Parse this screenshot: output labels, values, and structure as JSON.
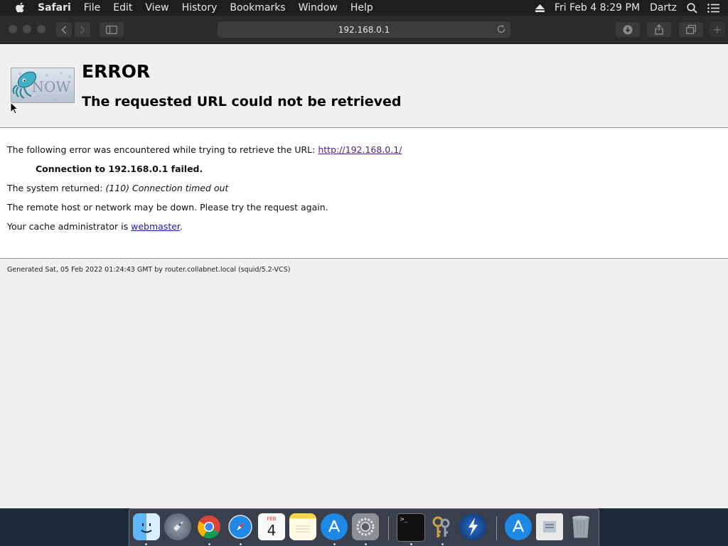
{
  "menubar": {
    "app_name": "Safari",
    "items": [
      "File",
      "Edit",
      "View",
      "History",
      "Bookmarks",
      "Window",
      "Help"
    ],
    "datetime": "Fri Feb 4  8:29 PM",
    "user": "Dartz"
  },
  "browser": {
    "address": "192.168.0.1"
  },
  "page": {
    "logo_text": "NOW",
    "title": "ERROR",
    "subtitle": "The requested URL could not be retrieved",
    "line1_prefix": "The following error was encountered while trying to retrieve the URL: ",
    "line1_link": "http://192.168.0.1/",
    "line2": "Connection to 192.168.0.1 failed.",
    "line3_prefix": "The system returned: ",
    "line3_value": "(110) Connection timed out",
    "line4": "The remote host or network may be down. Please try the request again.",
    "line5_prefix": "Your cache administrator is ",
    "line5_link": "webmaster",
    "line5_suffix": ".",
    "footer": "Generated Sat, 05 Feb 2022 01:24:43 GMT by router.collabnet.local (squid/5.2-VCS)"
  },
  "calendar_icon": {
    "month": "FEB",
    "day": "4"
  }
}
